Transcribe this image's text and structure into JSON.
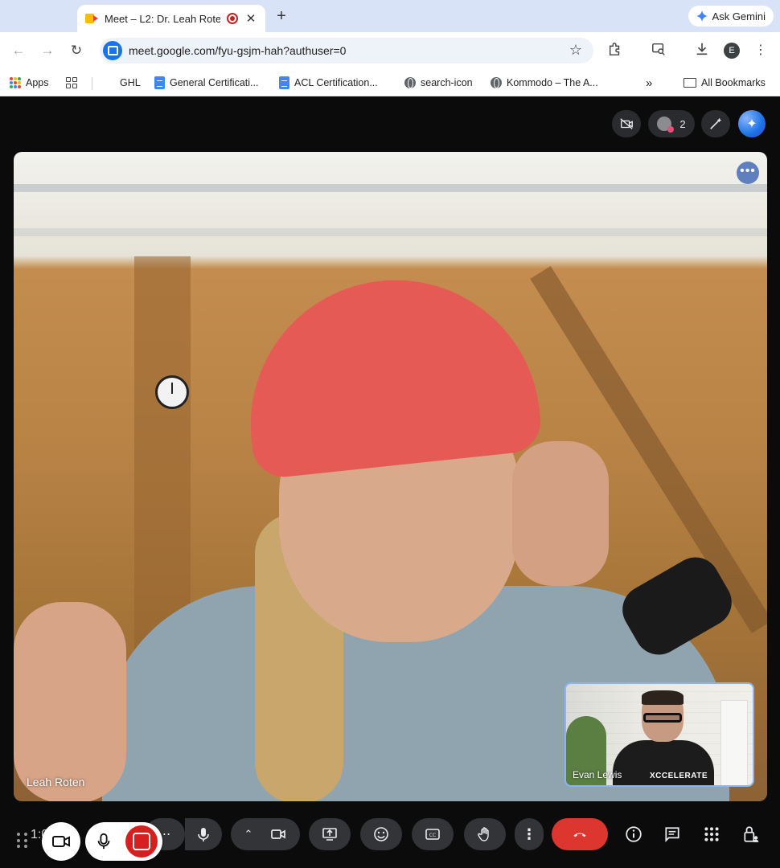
{
  "browser": {
    "tab_title": "Meet – L2: Dr. Leah Roten",
    "new_tab_symbol": "+",
    "close_symbol": "✕",
    "ask_gemini": "Ask Gemini",
    "url": "meet.google.com/fyu-gsjm-hah?authuser=0",
    "profile_initial": "E"
  },
  "bookmarks": [
    {
      "label": "Apps",
      "icon": "apps-grid-icon"
    },
    {
      "label": "",
      "icon": "grid-icon"
    },
    {
      "label": "GHL",
      "icon": ""
    },
    {
      "label": "General Certificati...",
      "icon": "doc-icon"
    },
    {
      "label": "ACL Certification...",
      "icon": "doc-icon"
    },
    {
      "label": "search-icon",
      "icon": "globe-icon"
    },
    {
      "label": "Kommodo – The A...",
      "icon": "globe-icon"
    },
    {
      "label": "»",
      "icon": ""
    },
    {
      "label": "All Bookmarks",
      "icon": "folder-icon"
    }
  ],
  "meet": {
    "participant_count": "2",
    "main_participant": "Leah Roten",
    "self_participant": "Evan Lewis",
    "self_logo_text": "XCCELERATE",
    "more_options": "•••",
    "recording_time": "1:08"
  },
  "colors": {
    "end_call": "#dc362e",
    "accent_blue": "#1a73e8",
    "control_bg": "#333437"
  }
}
